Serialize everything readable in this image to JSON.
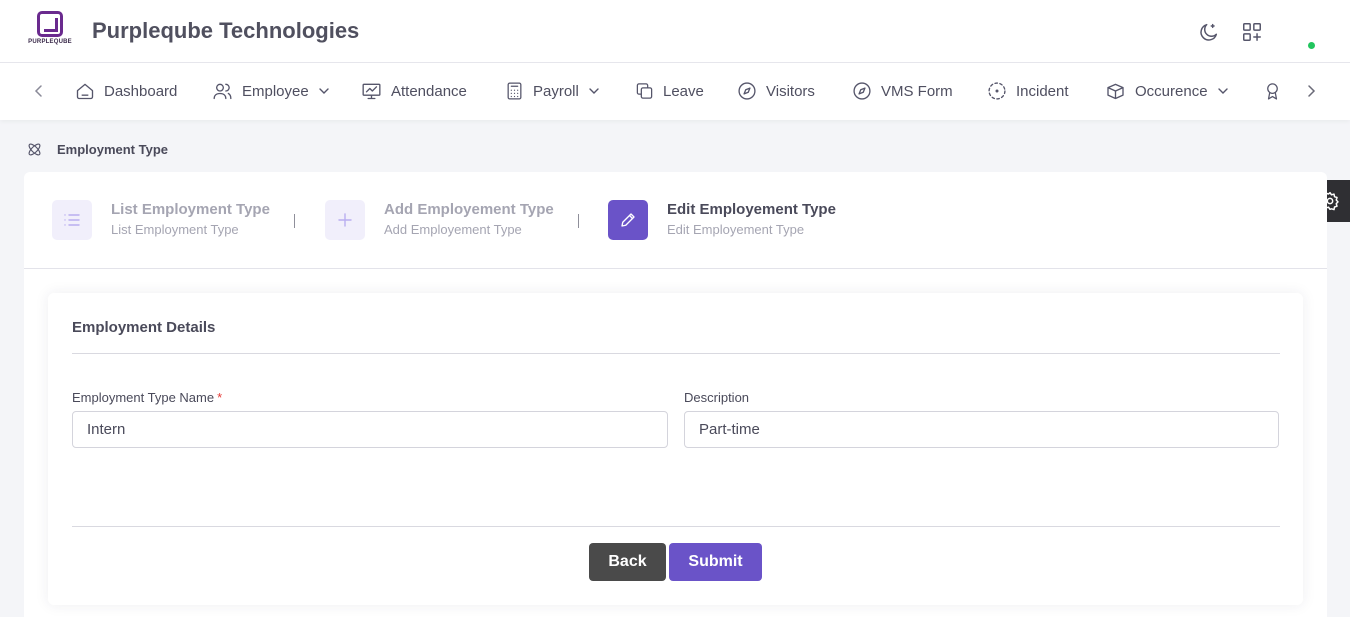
{
  "header": {
    "logo_text": "PURPLEQUBE",
    "company_name": "Purpleqube Technologies",
    "icons": [
      "moon-icon",
      "apps-add-icon"
    ],
    "status_color": "#22c55e"
  },
  "nav": {
    "items": [
      {
        "label": "Dashboard",
        "icon": "home-icon",
        "has_dropdown": false
      },
      {
        "label": "Employee",
        "icon": "users-icon",
        "has_dropdown": true
      },
      {
        "label": "Attendance",
        "icon": "monitor-chart-icon",
        "has_dropdown": false
      },
      {
        "label": "Payroll",
        "icon": "calculator-icon",
        "has_dropdown": true
      },
      {
        "label": "Leave",
        "icon": "copy-icon",
        "has_dropdown": false
      },
      {
        "label": "Visitors",
        "icon": "compass-icon",
        "has_dropdown": false
      },
      {
        "label": "VMS Form",
        "icon": "compass-icon",
        "has_dropdown": false
      },
      {
        "label": "Incident",
        "icon": "focus-icon",
        "has_dropdown": false
      },
      {
        "label": "Occurence",
        "icon": "boxes-icon",
        "has_dropdown": true
      },
      {
        "label": "",
        "icon": "award-icon",
        "has_dropdown": false
      }
    ]
  },
  "breadcrumb": {
    "label": "Employment Type",
    "icon": "atom-icon"
  },
  "steps": [
    {
      "title": "List Employment Type",
      "subtitle": "List Employment Type",
      "icon": "list-icon",
      "active": false
    },
    {
      "title": "Add Employement Type",
      "subtitle": "Add Employement Type",
      "icon": "plus-icon",
      "active": false
    },
    {
      "title": "Edit Employement Type",
      "subtitle": "Edit Employement Type",
      "icon": "pencil-icon",
      "active": true
    }
  ],
  "form": {
    "title": "Employment Details",
    "name_label": "Employment Type Name",
    "required_mark": "*",
    "name_value": "Intern",
    "description_label": "Description",
    "description_value": "Part-time"
  },
  "buttons": {
    "back": "Back",
    "submit": "Submit"
  },
  "colors": {
    "accent": "#6a53c8",
    "back_button": "#4a4a4a",
    "brand": "#6a2a8e"
  }
}
